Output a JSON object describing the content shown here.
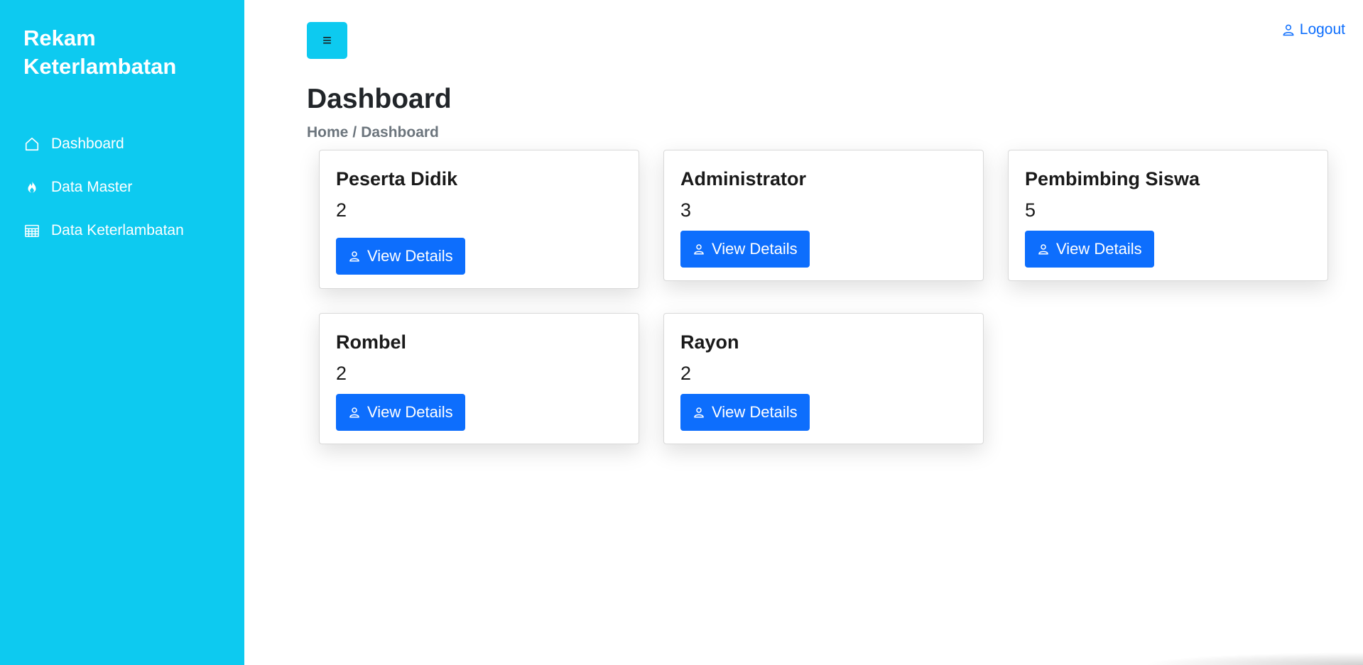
{
  "sidebar": {
    "brand": "Rekam Keterlambatan",
    "items": [
      {
        "label": "Dashboard",
        "icon": "home-icon"
      },
      {
        "label": "Data Master",
        "icon": "fire-icon"
      },
      {
        "label": "Data Keterlambatan",
        "icon": "calendar-icon"
      }
    ]
  },
  "header": {
    "toggle_icon": "≡",
    "logout_label": "Logout"
  },
  "main": {
    "title": "Dashboard",
    "breadcrumb": {
      "home": "Home",
      "separator": "/",
      "current": "Dashboard"
    },
    "cards": [
      {
        "title": "Peserta Didik",
        "count": "2",
        "button": "View Details"
      },
      {
        "title": "Administrator",
        "count": "3",
        "button": "View Details"
      },
      {
        "title": "Pembimbing Siswa",
        "count": "5",
        "button": "View Details"
      },
      {
        "title": "Rombel",
        "count": "2",
        "button": "View Details"
      },
      {
        "title": "Rayon",
        "count": "2",
        "button": "View Details"
      }
    ]
  },
  "colors": {
    "sidebar_bg": "#0dcaf0",
    "primary": "#0d6efd",
    "muted": "#6c757d"
  }
}
